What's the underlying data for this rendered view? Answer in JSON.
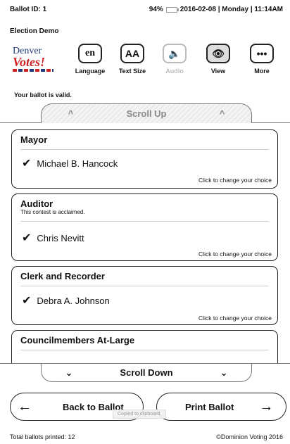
{
  "status": {
    "ballot_id": "Ballot ID: 1",
    "battery": "94%",
    "datetime": "2016-02-08 | Monday | 11:14AM"
  },
  "election_name": "Election Demo",
  "logo": {
    "line1": "Denver",
    "line2": "Votes!"
  },
  "toolbar": {
    "language": {
      "icon_text": "en",
      "label": "Language",
      "icon": "language-icon"
    },
    "text_size": {
      "icon_text": "AA",
      "label": "Text Size",
      "icon": "text-size-icon"
    },
    "audio": {
      "icon_text": "🔈",
      "label": "Audio",
      "icon": "speaker-icon"
    },
    "view": {
      "icon_text": "👁",
      "label": "View",
      "icon": "eye-icon"
    },
    "more": {
      "icon_text": "•••",
      "label": "More",
      "icon": "ellipsis-icon"
    }
  },
  "ballot_status": "Your ballot is valid.",
  "scroll_up": {
    "label": "Scroll Up",
    "left_chevron": "^",
    "right_chevron": "^"
  },
  "scroll_down": {
    "label": "Scroll Down",
    "left_chevron": "⌄",
    "right_chevron": "⌄"
  },
  "contests": [
    {
      "title": "Mayor",
      "note": "",
      "choice": "Michael B. Hancock",
      "change": "Click to change your choice"
    },
    {
      "title": "Auditor",
      "note": "This contest is acclaimed.",
      "choice": "Chris Nevitt",
      "change": "Click to change your choice"
    },
    {
      "title": "Clerk and Recorder",
      "note": "",
      "choice": "Debra A. Johnson",
      "change": "Click to change your choice"
    },
    {
      "title": "Councilmembers At-Large",
      "note": "",
      "choice": "",
      "change": ""
    }
  ],
  "nav": {
    "back": "Back to Ballot",
    "print": "Print Ballot"
  },
  "toast": "Copied to clipboard.",
  "footer": {
    "left": "Total ballots printed: 12",
    "right": "©Dominion Voting 2016"
  },
  "colors": {
    "accent": "#222222",
    "disabled": "#bbbbbb",
    "logo_blue": "#1f3b7a",
    "logo_red": "#cc2222"
  }
}
